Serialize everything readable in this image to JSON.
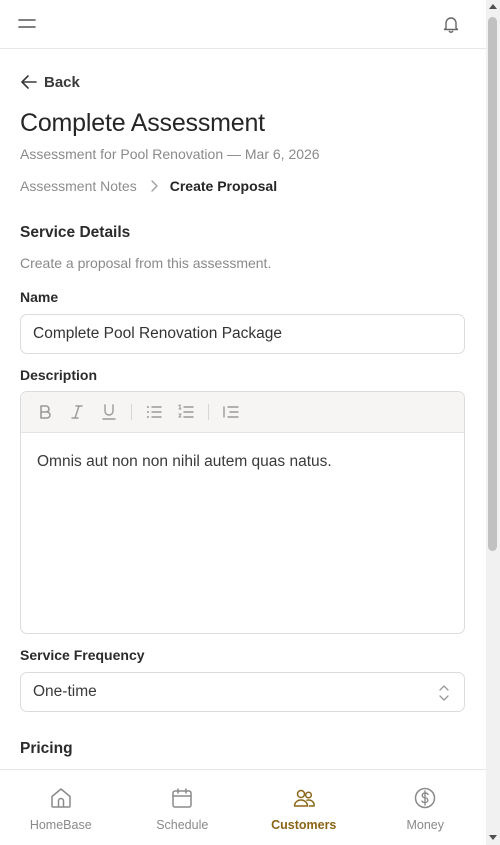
{
  "header": {
    "menu_icon": "menu-icon",
    "notification_icon": "bell-icon"
  },
  "nav": {
    "back_label": "Back"
  },
  "page": {
    "title": "Complete Assessment",
    "subtitle": "Assessment for Pool Renovation — Mar 6, 2026"
  },
  "breadcrumb": {
    "items": [
      "Assessment Notes",
      "Create Proposal"
    ]
  },
  "form": {
    "section_title": "Service Details",
    "section_description": "Create a proposal from this assessment.",
    "name_label": "Name",
    "name_value": "Complete Pool Renovation Package",
    "description_label": "Description",
    "description_value": "Omnis aut non non nihil autem quas natus.",
    "toolbar_icons": [
      "bold-icon",
      "italic-icon",
      "underline-icon",
      "bullet-list-icon",
      "numbered-list-icon",
      "indent-icon"
    ],
    "frequency_label": "Service Frequency",
    "frequency_value": "One-time",
    "pricing_title": "Pricing"
  },
  "bottom_nav": {
    "items": [
      {
        "label": "HomeBase",
        "icon": "home-icon",
        "active": false
      },
      {
        "label": "Schedule",
        "icon": "calendar-icon",
        "active": false
      },
      {
        "label": "Customers",
        "icon": "customers-icon",
        "active": true
      },
      {
        "label": "Money",
        "icon": "dollar-icon",
        "active": false
      }
    ]
  },
  "colors": {
    "accent": "#8a6516",
    "muted": "#8a8a8a",
    "text": "#2b2b2b",
    "toolbar_bg": "#f6f5f3"
  }
}
